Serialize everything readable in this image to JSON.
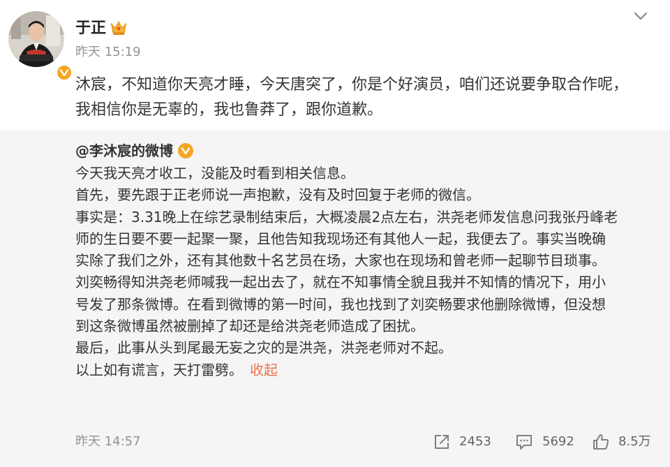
{
  "post": {
    "author": "于正",
    "time": "昨天 15:19",
    "text_lines": [
      "沐宸，不知道你天亮才睡，今天唐突了，你是个好演员，咱们还说要争取合作呢，",
      "我相信你是无辜的，我也鲁莽了，跟你道歉。"
    ]
  },
  "quote": {
    "author": "@李沐宸的微博",
    "lines": [
      "今天我天亮才收工，没能及时看到相关信息。",
      "首先，要先跟于正老师说一声抱歉，没有及时回复于老师的微信。",
      "事实是：3.31晚上在综艺录制结束后，大概凌晨2点左右，洪尧老师发信息问我张丹峰老",
      "师的生日要不要一起聚一聚，且他告知我现场还有其他人一起，我便去了。事实当晚确",
      "实除了我们之外，还有其他数十名艺员在场，大家也在现场和曾老师一起聊节目琐事。",
      "刘奕畅得知洪尧老师喊我一起出去了，就在不知事情全貌且我并不知情的情况下，用小",
      "号发了那条微博。在看到微博的第一时间，我也找到了刘奕畅要求他删除微博，但没想",
      "到这条微博虽然被删掉了却还是给洪尧老师造成了困扰。",
      "最后，此事从头到尾最无妄之灾的是洪尧，洪尧老师对不起。",
      "以上如有谎言，天打雷劈。"
    ],
    "collapse_label": "收起",
    "time": "昨天 14:57",
    "repost_count": "2453",
    "comment_count": "5692",
    "like_count": "8.5万"
  },
  "icons": {
    "menu": "chevron-down-icon",
    "verified": "verified-badge-icon",
    "crown": "crown-icon",
    "repost": "repost-icon",
    "comment": "comment-icon",
    "like": "like-icon"
  },
  "colors": {
    "accent": "#eb7350",
    "verified_badge": "#f5a623",
    "quote_bg": "#f5f5f5",
    "muted": "#939393"
  }
}
